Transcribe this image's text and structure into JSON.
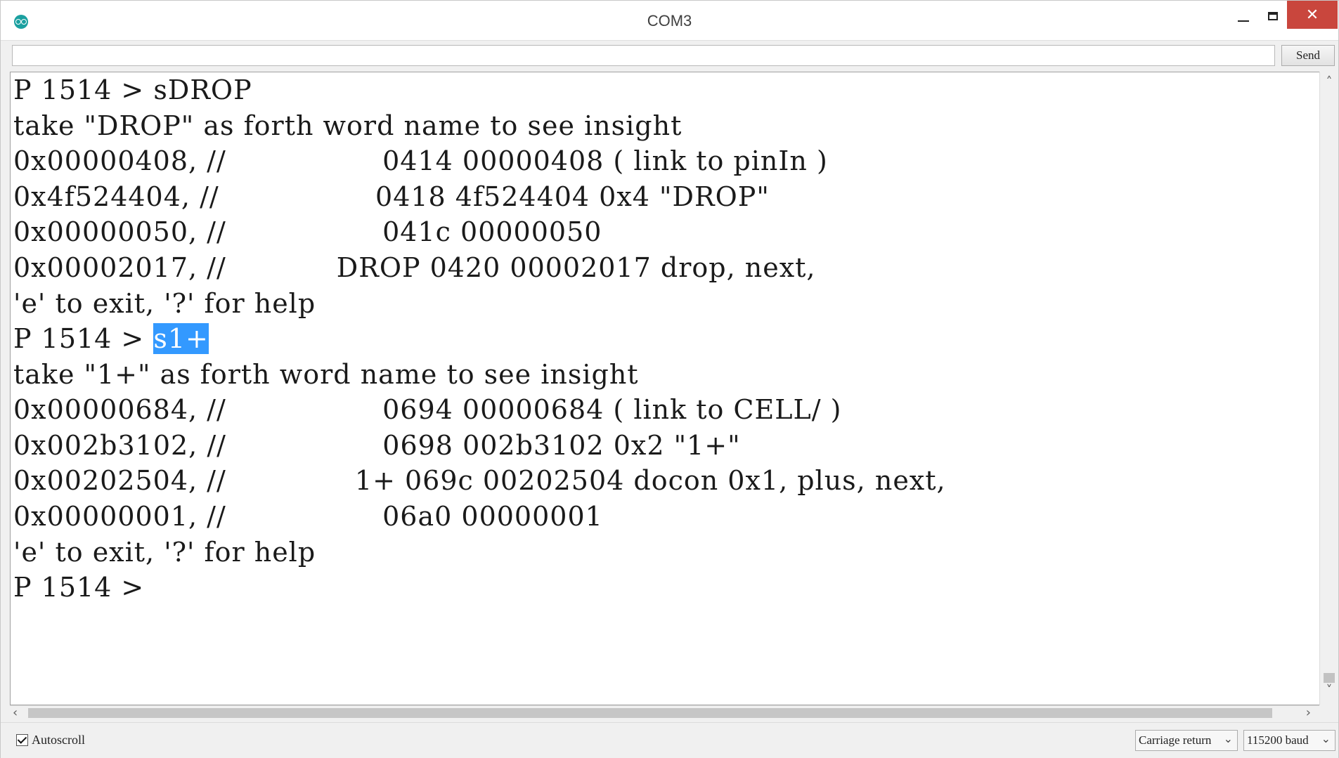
{
  "window": {
    "title": "COM3",
    "icons": {
      "app": "arduino-icon",
      "minimize": "minimize-icon",
      "maximize": "maximize-icon",
      "close": "close-icon"
    }
  },
  "send_row": {
    "input_value": "",
    "send_label": "Send"
  },
  "output": {
    "lines": [
      "P 1514 > sDROP",
      "take \"DROP\" as forth word name to see insight",
      "0x00000408, //                 0414 00000408 ( link to pinIn )",
      "0x4f524404, //                 0418 4f524404 0x4 \"DROP\"",
      "0x00000050, //                 041c 00000050",
      "0x00002017, //            DROP 0420 00002017 drop, next,",
      "'e' to exit, '?' for help",
      "take \"1+\" as forth word name to see insight",
      "0x00000684, //                 0694 00000684 ( link to CELL/ )",
      "0x002b3102, //                 0698 002b3102 0x2 \"1+\"",
      "0x00202504, //              1+ 069c 00202504 docon 0x1, plus, next,",
      "0x00000001, //                 06a0 00000001",
      "'e' to exit, '?' for help",
      "P 1514 >"
    ],
    "prompt_line": {
      "prefix": "P 1514 > ",
      "selected": "s1+"
    }
  },
  "bottom_bar": {
    "autoscroll_label": "Autoscroll",
    "autoscroll_checked": true,
    "line_ending": "Carriage return",
    "baud": "115200 baud"
  }
}
